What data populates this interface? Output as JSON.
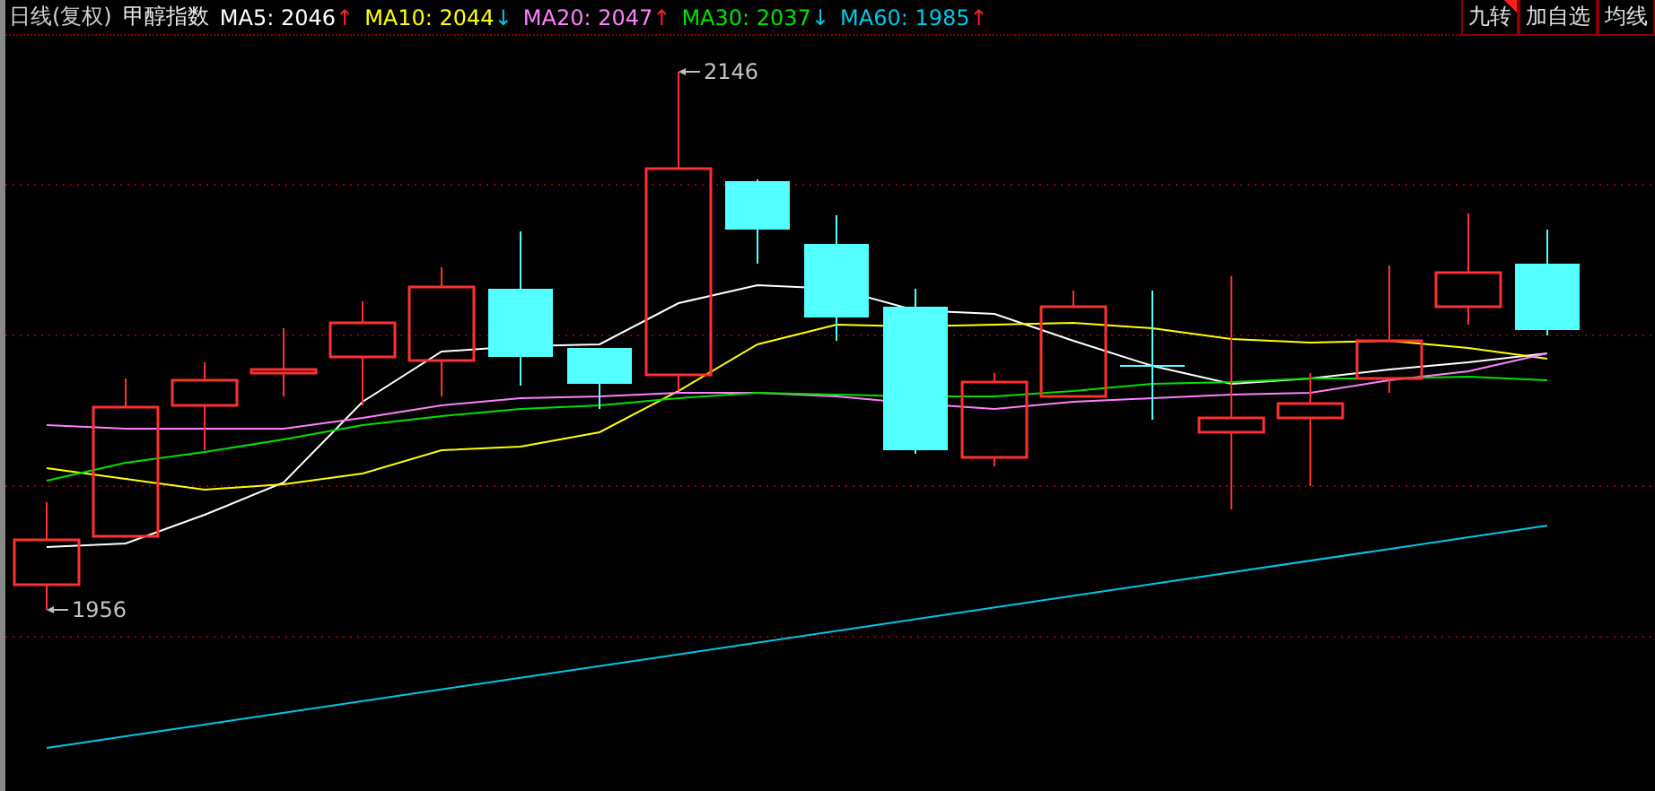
{
  "header": {
    "period": "日线(复权)",
    "instrument": "甲醇指数",
    "moving_averages": [
      {
        "label": "MA5:",
        "value": "2046",
        "arrow": "↑",
        "rising": true,
        "color": "#ffffff"
      },
      {
        "label": "MA10:",
        "value": "2044",
        "arrow": "↓",
        "rising": false,
        "color": "#ffff00"
      },
      {
        "label": "MA20:",
        "value": "2047",
        "arrow": "↑",
        "rising": true,
        "color": "#ff80ff"
      },
      {
        "label": "MA30:",
        "value": "2037",
        "arrow": "↓",
        "rising": false,
        "color": "#00e000"
      },
      {
        "label": "MA60:",
        "value": "1985",
        "arrow": "↑",
        "rising": true,
        "color": "#00c8e8"
      }
    ],
    "buttons": [
      {
        "label": "九转",
        "flagged": true
      },
      {
        "label": "加自选",
        "flagged": false
      },
      {
        "label": "均线",
        "flagged": false
      }
    ]
  },
  "chart": {
    "high_marker": "2146",
    "low_marker": "1956"
  }
}
